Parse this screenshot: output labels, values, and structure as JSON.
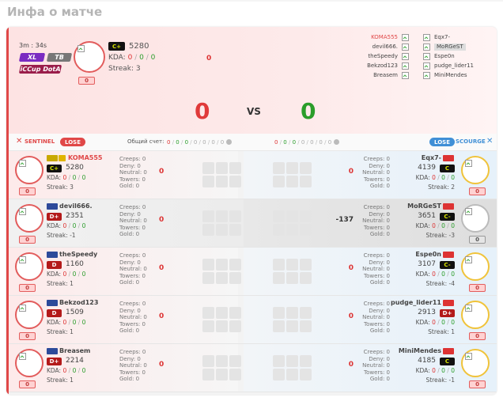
{
  "page_title": "Инфа о матче",
  "match": {
    "time": "3m : 34s",
    "mode_badges": [
      "XL",
      "TB",
      "iCCup DotA"
    ],
    "host_rank": "C+",
    "host_rating": "5280",
    "host_kda_label": "KDA:",
    "host_kda": [
      "0",
      "0",
      "0"
    ],
    "host_streak": "Streak: 3",
    "host_score_box": "0",
    "center_value": "0",
    "score_left": "0",
    "vs": "VS",
    "score_right": "0"
  },
  "pairs": [
    {
      "left": "KOMA555",
      "right": "Eqx7-"
    },
    {
      "left": "devil666.",
      "right": "MoRGeST"
    },
    {
      "left": "theSpeedy",
      "right": "Espe0n"
    },
    {
      "left": "Bekzod123",
      "right": "pudge_lider11"
    },
    {
      "left": "Breasem",
      "right": "MiniMendes"
    }
  ],
  "bar": {
    "sentinel": "SENTINEL",
    "sentinel_result": "LOSE",
    "total_label": "Общий счет:",
    "total_left": [
      "0",
      "0",
      "0",
      "0",
      "0",
      "0",
      "0"
    ],
    "total_right": [
      "0",
      "0",
      "0",
      "0",
      "0",
      "0",
      "0"
    ],
    "scourge_result": "LOSE",
    "scourge": "SCOURGE"
  },
  "stat_labels": [
    "Creeps: 0",
    "Deny: 0",
    "Neutral: 0",
    "Towers: 0",
    "Gold: 0"
  ],
  "players": [
    {
      "l_name": "KOMA555",
      "l_rank": "C+",
      "l_rating": "5280",
      "l_kda": [
        "0",
        "0",
        "0"
      ],
      "l_streak": "Streak: 3",
      "l_box": "0",
      "l_delta": "0",
      "r_name": "Eqx7-",
      "r_rank": "C",
      "r_rating": "4139",
      "r_kda": [
        "0",
        "0",
        "0"
      ],
      "r_streak": "Streak: 2",
      "r_box": "0",
      "r_delta": "0"
    },
    {
      "l_name": "devil666.",
      "l_rank": "D+",
      "l_rating": "2351",
      "l_kda": [
        "0",
        "0",
        "0"
      ],
      "l_streak": "Streak: -1",
      "l_box": "0",
      "l_delta": "0",
      "r_name": "MoRGeST",
      "r_rank": "C-",
      "r_rating": "3651",
      "r_kda": [
        "0",
        "0",
        "0"
      ],
      "r_streak": "Streak: -3",
      "r_box": "0",
      "r_delta": "-137"
    },
    {
      "l_name": "theSpeedy",
      "l_rank": "D",
      "l_rating": "1160",
      "l_kda": [
        "0",
        "0",
        "0"
      ],
      "l_streak": "Streak: 1",
      "l_box": "0",
      "l_delta": "0",
      "r_name": "Espe0n",
      "r_rank": "C-",
      "r_rating": "3107",
      "r_kda": [
        "0",
        "0",
        "0"
      ],
      "r_streak": "Streak: -4",
      "r_box": "0",
      "r_delta": "0"
    },
    {
      "l_name": "Bekzod123",
      "l_rank": "D",
      "l_rating": "1509",
      "l_kda": [
        "0",
        "0",
        "0"
      ],
      "l_streak": "Streak: 1",
      "l_box": "0",
      "l_delta": "0",
      "r_name": "pudge_lider11",
      "r_rank": "D+",
      "r_rating": "2913",
      "r_kda": [
        "0",
        "0",
        "0"
      ],
      "r_streak": "Streak: 1",
      "r_box": "0",
      "r_delta": "0"
    },
    {
      "l_name": "Breasem",
      "l_rank": "D+",
      "l_rating": "2214",
      "l_kda": [
        "0",
        "0",
        "0"
      ],
      "l_streak": "Streak: 1",
      "l_box": "0",
      "l_delta": "0",
      "r_name": "MiniMendes",
      "r_rank": "C",
      "r_rating": "4185",
      "r_kda": [
        "0",
        "0",
        "0"
      ],
      "r_streak": "Streak: -1",
      "r_box": "0",
      "r_delta": "0"
    }
  ],
  "colors": {
    "sentinel": "#e04848",
    "scourge": "#3f8fd6",
    "accent_green": "#2a9d2a"
  }
}
